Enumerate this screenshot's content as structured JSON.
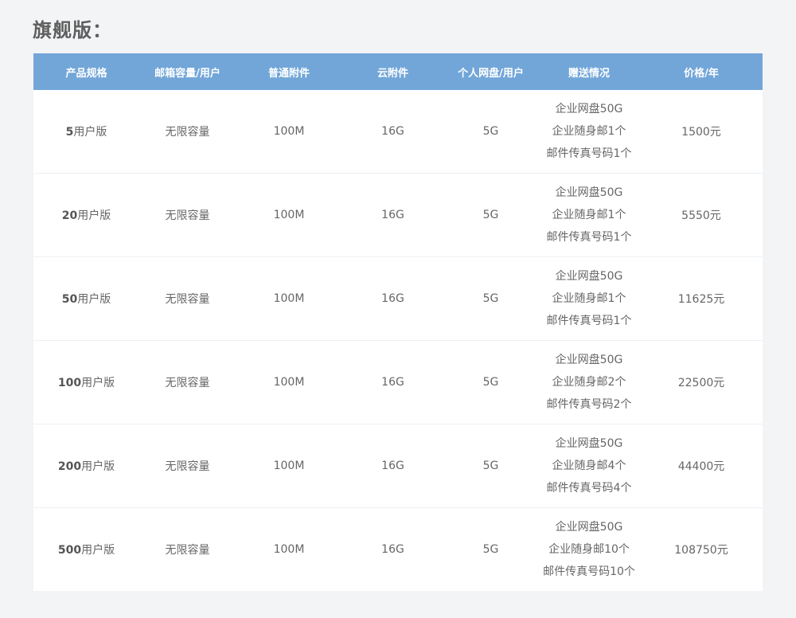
{
  "page": {
    "title": "旗舰版："
  },
  "table": {
    "headers": [
      "产品规格",
      "邮箱容量/用户",
      "普通附件",
      "云附件",
      "个人网盘/用户",
      "赠送情况",
      "价格/年"
    ],
    "suffix": "用户版",
    "rows": [
      {
        "users": "5",
        "capacity": "无限容量",
        "attachment": "100M",
        "cloud": "16G",
        "disk": "5G",
        "gifts": [
          "企业网盘50G",
          "企业随身邮1个",
          "邮件传真号码1个"
        ],
        "price": "1500元"
      },
      {
        "users": "20",
        "capacity": "无限容量",
        "attachment": "100M",
        "cloud": "16G",
        "disk": "5G",
        "gifts": [
          "企业网盘50G",
          "企业随身邮1个",
          "邮件传真号码1个"
        ],
        "price": "5550元"
      },
      {
        "users": "50",
        "capacity": "无限容量",
        "attachment": "100M",
        "cloud": "16G",
        "disk": "5G",
        "gifts": [
          "企业网盘50G",
          "企业随身邮1个",
          "邮件传真号码1个"
        ],
        "price": "11625元"
      },
      {
        "users": "100",
        "capacity": "无限容量",
        "attachment": "100M",
        "cloud": "16G",
        "disk": "5G",
        "gifts": [
          "企业网盘50G",
          "企业随身邮2个",
          "邮件传真号码2个"
        ],
        "price": "22500元"
      },
      {
        "users": "200",
        "capacity": "无限容量",
        "attachment": "100M",
        "cloud": "16G",
        "disk": "5G",
        "gifts": [
          "企业网盘50G",
          "企业随身邮4个",
          "邮件传真号码4个"
        ],
        "price": "44400元"
      },
      {
        "users": "500",
        "capacity": "无限容量",
        "attachment": "100M",
        "cloud": "16G",
        "disk": "5G",
        "gifts": [
          "企业网盘50G",
          "企业随身邮10个",
          "邮件传真号码10个"
        ],
        "price": "108750元"
      }
    ]
  },
  "colors": {
    "header_bg": "#72a6d8",
    "page_bg": "#f3f4f6"
  }
}
